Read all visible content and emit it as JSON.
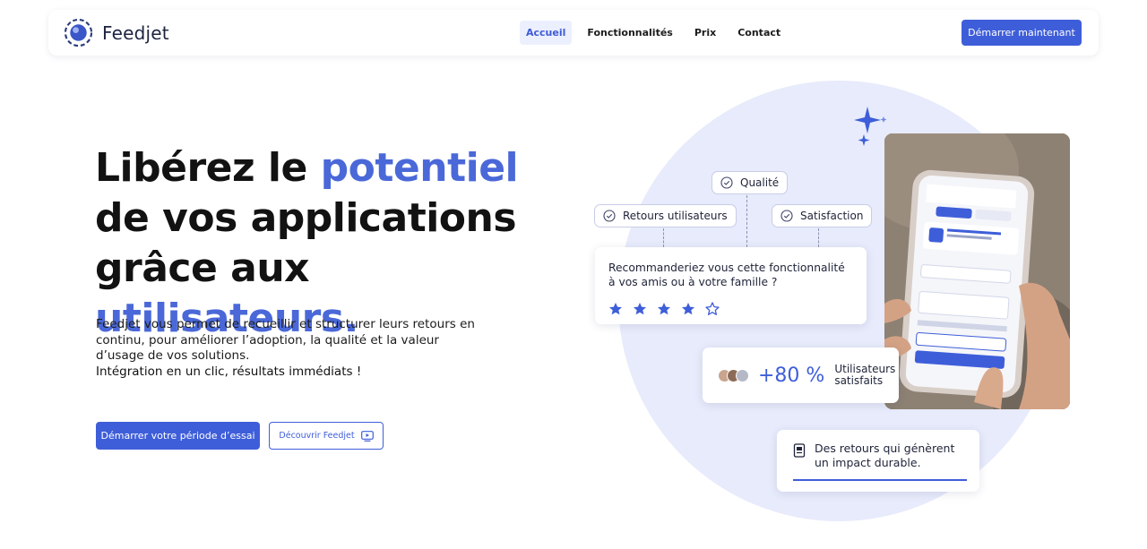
{
  "brand": {
    "name": "Feedjet"
  },
  "nav": {
    "links": [
      {
        "label": "Accueil",
        "active": true
      },
      {
        "label": "Fonctionnalités",
        "active": false
      },
      {
        "label": "Prix",
        "active": false
      },
      {
        "label": "Contact",
        "active": false
      }
    ],
    "cta_label": "Démarrer maintenant"
  },
  "hero": {
    "title_part1": "Libérez le ",
    "title_accent1": "potentiel",
    "title_part2": " de vos applications grâce aux ",
    "title_accent2": "utilisateurs.",
    "description": "Feedjet vous permet de recueillir et structurer leurs retours en continu, pour améliorer l’adoption, la qualité et la valeur d’usage de vos solutions.",
    "highlight": "Intégration en un clic, résultats immédiats !",
    "primary_button": "Démarrer votre période d’essai",
    "secondary_button": "Découvrir Feedjet"
  },
  "illustration": {
    "tags": [
      "Qualité",
      "Retours utilisateurs",
      "Satisfaction"
    ],
    "question": "Recommanderiez vous cette fonctionnalité à vos amis ou à votre famille ?",
    "rating": 4,
    "rating_max": 5,
    "stat_value": "+80 %",
    "stat_label_line1": "Utilisateurs",
    "stat_label_line2": "satisfaits",
    "impact_text": "Des retours qui génèrent un impact durable.",
    "impact_progress": 1.0
  },
  "colors": {
    "accent": "#3e5ed9",
    "accent_text": "#4a68d8",
    "circle": "#e7ebfb",
    "nav_active_bg": "#eceffd"
  }
}
